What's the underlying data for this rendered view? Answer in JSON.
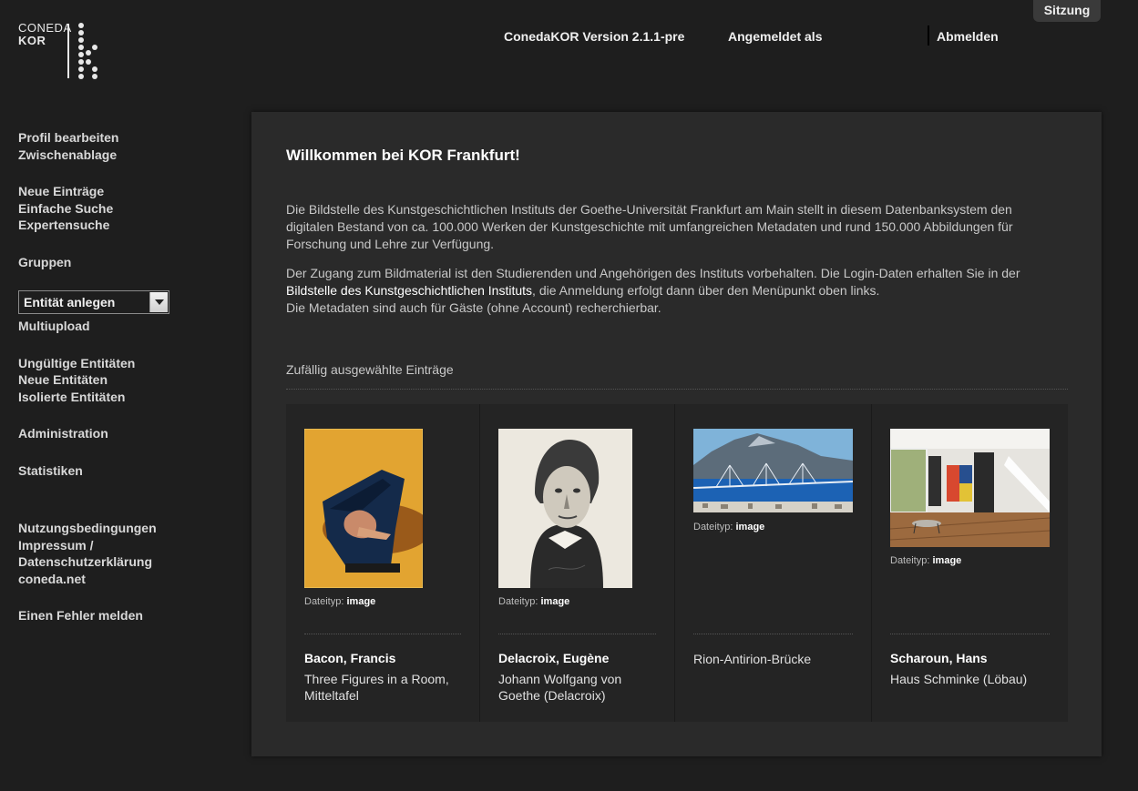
{
  "logo": {
    "line1": "CONEDA",
    "line2": "KOR"
  },
  "header": {
    "version": "ConedaKOR Version 2.1.1-pre",
    "logged_in_as": "Angemeldet als",
    "logout": "Abmelden",
    "session_tab": "Sitzung"
  },
  "sidebar": {
    "group1": [
      "Profil bearbeiten",
      "Zwischenablage"
    ],
    "group2": [
      "Neue Einträge",
      "Einfache Suche",
      "Expertensuche"
    ],
    "group3": [
      "Gruppen"
    ],
    "entity_select": "Entität anlegen",
    "multiupload": "Multiupload",
    "group5": [
      "Ungültige Entitäten",
      "Neue Entitäten",
      "Isolierte Entitäten"
    ],
    "group6": [
      "Administration"
    ],
    "group7": [
      "Statistiken"
    ],
    "group8": [
      "Nutzungsbedingungen",
      "Impressum /",
      "Datenschutzerklärung",
      "coneda.net"
    ],
    "group9": [
      "Einen Fehler melden"
    ]
  },
  "main": {
    "title": "Willkommen bei KOR Frankfurt!",
    "para1": "Die Bildstelle des Kunstgeschichtlichen Instituts der Goethe-Universität Frankfurt am Main stellt in diesem Datenbanksystem den digitalen Bestand von ca. 100.000 Werken der Kunstgeschichte mit umfangreichen Metadaten und rund 150.000 Abbildungen für Forschung und Lehre zur Verfügung.",
    "para2_pre": "Der Zugang zum Bildmaterial ist den Studierenden und Angehörigen des Instituts vorbehalten. Die Login-Daten erhalten Sie in der ",
    "para2_link": "Bildstelle des Kunstgeschichtlichen Instituts",
    "para2_post": ", die Anmeldung erfolgt dann über den Menüpunkt oben links.",
    "para3": "Die Metadaten sind auch für Gäste (ohne Account) recherchierbar.",
    "random_heading": "Zufällig ausgewählte Einträge",
    "filetype_label": "Dateityp:",
    "cards": [
      {
        "name": "Bacon, Francis",
        "title": "Three Figures in a Room, Mitteltafel",
        "filetype": "image"
      },
      {
        "name": "Delacroix, Eugène",
        "title": "Johann Wolfgang von Goethe (Delacroix)",
        "filetype": "image"
      },
      {
        "name": "",
        "title": "Rion-Antirion-Brücke",
        "filetype": "image"
      },
      {
        "name": "Scharoun, Hans",
        "title": "Haus Schminke (Löbau)",
        "filetype": "image"
      }
    ]
  },
  "colors": {
    "background": "#1e1e1e",
    "panel": "#2a2a2a",
    "card": "#242424",
    "text": "#d8d8d8"
  }
}
